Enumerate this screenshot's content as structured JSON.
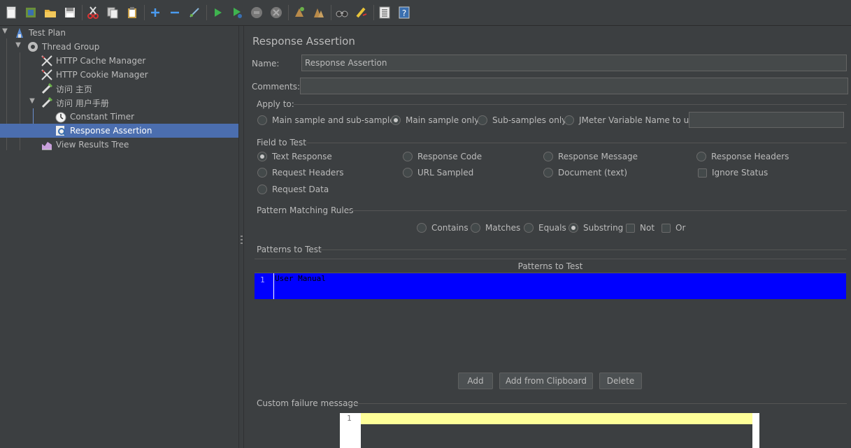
{
  "toolbar": {
    "buttons": [
      "new-icon",
      "templates-icon",
      "open-icon",
      "save-icon",
      "cut-icon",
      "copy-icon",
      "paste-icon",
      "expand-icon",
      "collapse-icon",
      "toggle-icon",
      "start-icon",
      "start-no-pause-icon",
      "stop-icon",
      "shutdown-icon",
      "clear-icon",
      "clear-all-icon",
      "search-icon",
      "reset-search-icon",
      "function-helper-icon",
      "help-icon"
    ]
  },
  "tree": {
    "items": [
      {
        "label": "Test Plan",
        "icon": "test-plan-icon"
      },
      {
        "label": "Thread Group",
        "icon": "gear-icon"
      },
      {
        "label": "HTTP Cache Manager",
        "icon": "tools-icon"
      },
      {
        "label": "HTTP Cookie Manager",
        "icon": "tools-icon"
      },
      {
        "label": "访问 主页",
        "icon": "sampler-icon"
      },
      {
        "label": "访问 用户手册",
        "icon": "sampler-icon"
      },
      {
        "label": "Constant Timer",
        "icon": "timer-icon"
      },
      {
        "label": "Response Assertion",
        "icon": "assertion-icon"
      },
      {
        "label": "View Results Tree",
        "icon": "listener-icon"
      }
    ],
    "selected": "Response Assertion"
  },
  "panel": {
    "title": "Response Assertion",
    "name_label": "Name:",
    "name_value": "Response Assertion",
    "comments_label": "Comments:",
    "comments_value": "",
    "apply_to": {
      "title": "Apply to:",
      "options": [
        "Main sample and sub-samples",
        "Main sample only",
        "Sub-samples only",
        "JMeter Variable Name to use"
      ],
      "selected": "Main sample only",
      "variable_value": ""
    },
    "field_to_test": {
      "title": "Field to Test",
      "options": [
        "Text Response",
        "Response Code",
        "Response Message",
        "Response Headers",
        "Request Headers",
        "URL Sampled",
        "Document (text)",
        "Ignore Status",
        "Request Data"
      ],
      "selected": "Text Response"
    },
    "pattern_rules": {
      "title": "Pattern Matching Rules",
      "options": [
        "Contains",
        "Matches",
        "Equals",
        "Substring",
        "Not",
        "Or"
      ],
      "selected": "Substring"
    },
    "patterns": {
      "title": "Patterns to Test",
      "column_header": "Patterns to Test",
      "rows": [
        {
          "line": "1",
          "text": "User Manual"
        }
      ]
    },
    "buttons": {
      "add": "Add",
      "add_clipboard": "Add from Clipboard",
      "delete": "Delete"
    },
    "custom_failure": {
      "title": "Custom failure message",
      "line": "1"
    }
  }
}
